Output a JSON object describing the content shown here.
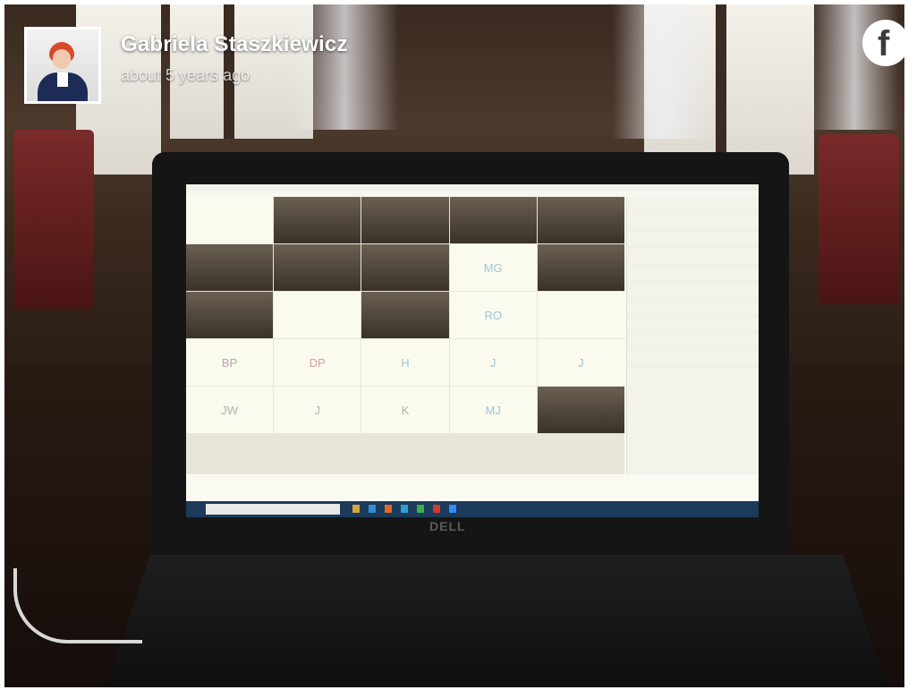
{
  "post": {
    "author": "Gabriela Staszkiewicz",
    "timestamp": "about 5 years ago"
  },
  "brand": {
    "icon": "facebook-icon",
    "glyph": "f"
  },
  "photo": {
    "laptop_brand": "DELL",
    "tile_initials": [
      "MG",
      "RO",
      "BP",
      "DP",
      "H",
      "J",
      "J",
      "JW",
      "J",
      "K",
      "MJ"
    ]
  },
  "colors": {
    "author_text": "#ffffff",
    "accent_initials": "#9ec6d6",
    "taskbar": "#1c3a5a"
  }
}
